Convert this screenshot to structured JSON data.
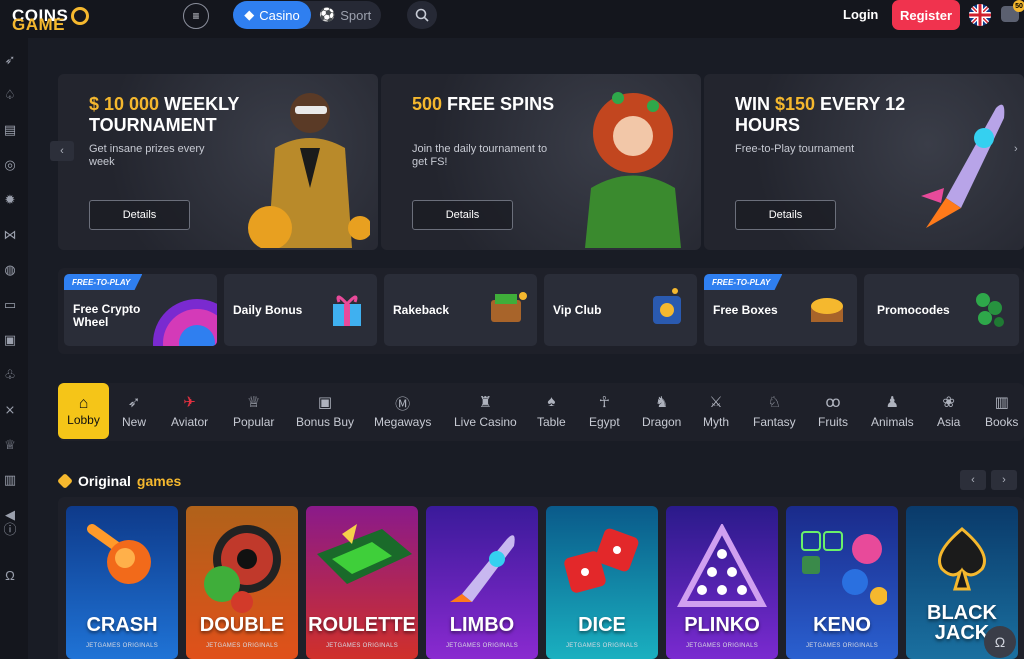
{
  "header": {
    "logo_left": "COINS",
    "logo_right": "GAME",
    "menu_icon": "menu-icon",
    "tabs": [
      {
        "label": "Casino",
        "icon": "diamond-icon"
      },
      {
        "label": "Sport",
        "icon": "ball-icon"
      }
    ],
    "login_label": "Login",
    "register_label": "Register",
    "chat_badge": "50"
  },
  "sidebar": {
    "icons": [
      "rocket-icon",
      "spade-icon",
      "basket-icon",
      "target-icon",
      "new-badge-icon",
      "handshake-icon",
      "basketball-icon",
      "gamepad-icon",
      "gift-icon",
      "tree-icon",
      "wands-icon",
      "crown-icon",
      "ticket-icon",
      "megaphone-icon",
      "help-icon",
      "headset-icon"
    ]
  },
  "banners": [
    {
      "title_highlight": "$ 10 000",
      "title_rest": " WEEKLY TOURNAMENT",
      "subtitle": "Get insane prizes every week",
      "button": "Details"
    },
    {
      "title_highlight": "500",
      "title_rest": " FREE SPINS",
      "subtitle": "Join the daily tournament to get FS!",
      "button": "Details"
    },
    {
      "title_prefix": "WIN ",
      "title_highlight": "$150",
      "title_rest": " EVERY 12 HOURS",
      "subtitle": "Free-to-Play tournament",
      "button": "Details"
    }
  ],
  "promos": [
    {
      "label": "Free Crypto Wheel",
      "badge": "FREE-TO-PLAY"
    },
    {
      "label": "Daily Bonus"
    },
    {
      "label": "Rakeback"
    },
    {
      "label": "Vip Club"
    },
    {
      "label": "Free Boxes",
      "badge": "FREE-TO-PLAY"
    },
    {
      "label": "Promocodes"
    }
  ],
  "categories": [
    {
      "label": "Lobby"
    },
    {
      "label": "New"
    },
    {
      "label": "Aviator"
    },
    {
      "label": "Popular"
    },
    {
      "label": "Bonus Buy"
    },
    {
      "label": "Megaways"
    },
    {
      "label": "Live Casino"
    },
    {
      "label": "Table"
    },
    {
      "label": "Egypt"
    },
    {
      "label": "Dragon"
    },
    {
      "label": "Myth"
    },
    {
      "label": "Fantasy"
    },
    {
      "label": "Fruits"
    },
    {
      "label": "Animals"
    },
    {
      "label": "Asia"
    },
    {
      "label": "Books"
    }
  ],
  "originals": {
    "title_main": "Original",
    "title_highlight": "games",
    "games": [
      {
        "name": "CRASH",
        "sub": "JETGAMES ORIGINALS"
      },
      {
        "name": "DOUBLE",
        "sub": "JETGAMES ORIGINALS"
      },
      {
        "name": "ROULETTE",
        "sub": "JETGAMES ORIGINALS"
      },
      {
        "name": "LIMBO",
        "sub": "JETGAMES ORIGINALS"
      },
      {
        "name": "DICE",
        "sub": "JETGAMES ORIGINALS"
      },
      {
        "name": "PLINKO",
        "sub": "JETGAMES ORIGINALS"
      },
      {
        "name": "KENO",
        "sub": "JETGAMES ORIGINALS"
      },
      {
        "name": "BLACK JACK",
        "sub": "JETGAMES ORIGINALS"
      }
    ]
  },
  "colors": {
    "accent": "#f5b82e",
    "primary": "#2f7ff0",
    "register": "#f0334e",
    "lobby": "#f5c518"
  }
}
